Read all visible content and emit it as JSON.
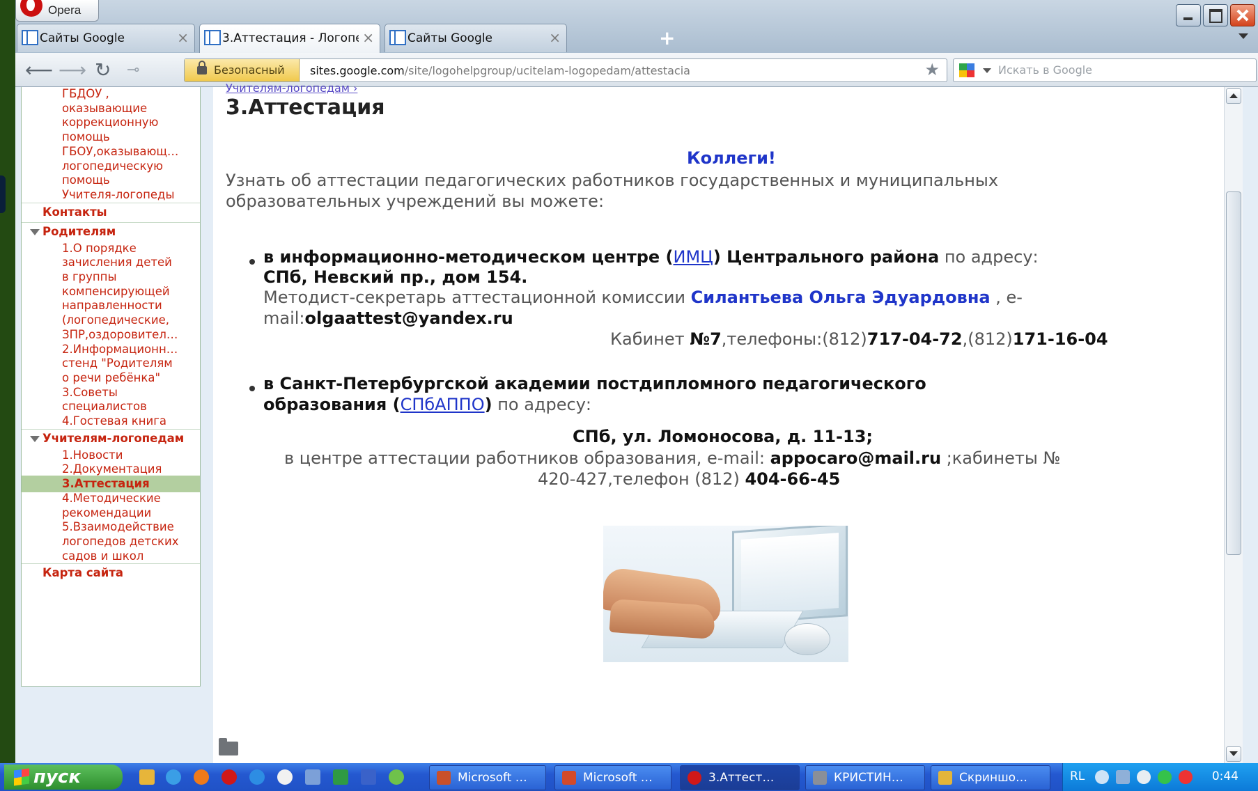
{
  "browser": {
    "menu_label": "Opera",
    "tabs": [
      {
        "label": "Сайты Google",
        "close": "×"
      },
      {
        "label": "3.Аттестация - Логопе…",
        "close": "×"
      },
      {
        "label": "Сайты Google",
        "close": "×"
      }
    ],
    "new_tab": "+",
    "security_label": "Безопасный",
    "url_host": "sites.google.com",
    "url_path": "/site/logohelpgroup/ucitelam-logopedam/attestacia",
    "search_placeholder": "Искать в Google"
  },
  "sidebar": {
    "items": [
      {
        "text": "ГБДОУ ,",
        "kind": "sub"
      },
      {
        "text": "оказывающие",
        "kind": "sub"
      },
      {
        "text": "коррекционную",
        "kind": "sub"
      },
      {
        "text": "помощь",
        "kind": "sub"
      },
      {
        "text": "ГБОУ,оказывающ…",
        "kind": "sub"
      },
      {
        "text": "логопедическую",
        "kind": "sub"
      },
      {
        "text": "помощь",
        "kind": "sub"
      },
      {
        "text": "Учителя-логопеды",
        "kind": "sub"
      },
      {
        "text": "Контакты",
        "kind": "top"
      },
      {
        "text": "Родителям",
        "kind": "top"
      },
      {
        "text": "1.О порядке",
        "kind": "sub"
      },
      {
        "text": "зачисления детей",
        "kind": "sub"
      },
      {
        "text": "в группы",
        "kind": "sub"
      },
      {
        "text": "компенсирующей",
        "kind": "sub"
      },
      {
        "text": "направленности",
        "kind": "sub"
      },
      {
        "text": "(логопедические,",
        "kind": "sub"
      },
      {
        "text": "ЗПР,оздоровител…",
        "kind": "sub"
      },
      {
        "text": "2.Информационн…",
        "kind": "sub"
      },
      {
        "text": "стенд \"Родителям",
        "kind": "sub"
      },
      {
        "text": "о речи ребёнка\"",
        "kind": "sub"
      },
      {
        "text": "3.Советы",
        "kind": "sub"
      },
      {
        "text": "специалистов",
        "kind": "sub"
      },
      {
        "text": "4.Гостевая книга",
        "kind": "sub"
      },
      {
        "text": "Учителям-логопедам",
        "kind": "top"
      },
      {
        "text": "1.Новости",
        "kind": "sub"
      },
      {
        "text": "2.Документация",
        "kind": "sub"
      },
      {
        "text": "3.Аттестация",
        "kind": "sub"
      },
      {
        "text": "4.Методические",
        "kind": "sub"
      },
      {
        "text": "рекомендации",
        "kind": "sub"
      },
      {
        "text": "5.Взаимодействие",
        "kind": "sub"
      },
      {
        "text": "логопедов детских",
        "kind": "sub"
      },
      {
        "text": "садов и школ",
        "kind": "sub"
      },
      {
        "text": "Карта сайта",
        "kind": "top"
      }
    ]
  },
  "page": {
    "breadcrumb": "Учителям-логопедам ›",
    "title": "3.Аттестация",
    "greeting": "Коллеги!",
    "intro_1": "Узнать об аттестации педагогических работников государственных и муниципальных",
    "intro_2": "образовательных учреждений вы можете:",
    "b1_a": "в информационно-методическом центре (",
    "b1_link": "ИМЦ",
    "b1_b": ") Центрального района",
    "b1_c": " по адресу:",
    "b1_address": "СПб, Невский пр., дом 154.",
    "b1_role": "Методист-секретарь аттестационной комиссии ",
    "b1_person": "Силантьева Ольга Эдуардовна",
    "b1_email_pre": " , e-",
    "b1_email_label": "mail:",
    "b1_email": "olgaattest@yandex.ru",
    "b1_cab_label": "Кабинет ",
    "b1_cab": "№7",
    "b1_phones_label": ",телефоны:",
    "b1_code1": "(812)",
    "b1_phone1": "717-04-72",
    "b1_code2": ",(812)",
    "b1_phone2": "171-16-04",
    "b2_a": "в Санкт-Петербургской академии постдипломного педагогического",
    "b2_b": "образования (",
    "b2_link": "СПбАППО",
    "b2_c": ")",
    "b2_d": " по адресу:",
    "b2_address": "СПб, ул. Ломоносова, д. 11-13;",
    "b2_center": "в центре   аттестации работников образования, e-mail: ",
    "b2_email": "appocaro@mail.ru",
    "b2_cab": " ;кабинеты №",
    "b2_rooms": "420-427,телефон (812) ",
    "b2_phone": "404-66-45"
  },
  "taskbar": {
    "start_label": "пуск",
    "tasks": [
      {
        "label": "Microsoft …",
        "color": "#c9502a"
      },
      {
        "label": "Microsoft …",
        "color": "#d24a2a"
      },
      {
        "label": "3.Аттест…",
        "color": "#d01818"
      },
      {
        "label": "КРИСТИН…",
        "color": "#8a8f98"
      },
      {
        "label": "Скриншо…",
        "color": "#e3b53a"
      }
    ],
    "lang": "RL",
    "clock": "0:44"
  }
}
